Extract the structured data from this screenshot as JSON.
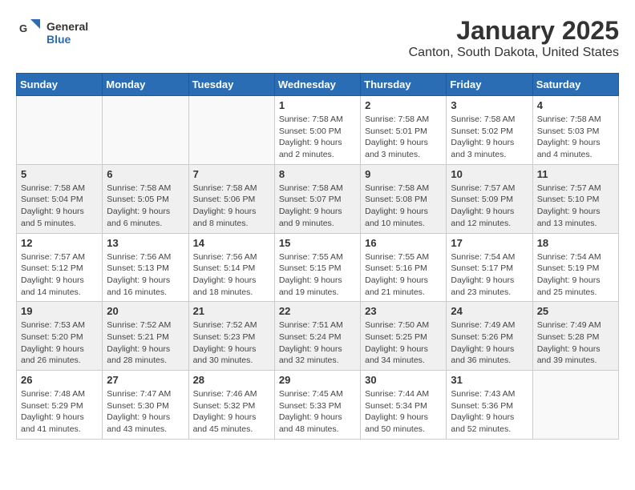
{
  "logo": {
    "general": "General",
    "blue": "Blue"
  },
  "title": "January 2025",
  "subtitle": "Canton, South Dakota, United States",
  "headers": [
    "Sunday",
    "Monday",
    "Tuesday",
    "Wednesday",
    "Thursday",
    "Friday",
    "Saturday"
  ],
  "weeks": [
    [
      {
        "day": "",
        "info": ""
      },
      {
        "day": "",
        "info": ""
      },
      {
        "day": "",
        "info": ""
      },
      {
        "day": "1",
        "info": "Sunrise: 7:58 AM\nSunset: 5:00 PM\nDaylight: 9 hours and 2 minutes."
      },
      {
        "day": "2",
        "info": "Sunrise: 7:58 AM\nSunset: 5:01 PM\nDaylight: 9 hours and 3 minutes."
      },
      {
        "day": "3",
        "info": "Sunrise: 7:58 AM\nSunset: 5:02 PM\nDaylight: 9 hours and 3 minutes."
      },
      {
        "day": "4",
        "info": "Sunrise: 7:58 AM\nSunset: 5:03 PM\nDaylight: 9 hours and 4 minutes."
      }
    ],
    [
      {
        "day": "5",
        "info": "Sunrise: 7:58 AM\nSunset: 5:04 PM\nDaylight: 9 hours and 5 minutes."
      },
      {
        "day": "6",
        "info": "Sunrise: 7:58 AM\nSunset: 5:05 PM\nDaylight: 9 hours and 6 minutes."
      },
      {
        "day": "7",
        "info": "Sunrise: 7:58 AM\nSunset: 5:06 PM\nDaylight: 9 hours and 8 minutes."
      },
      {
        "day": "8",
        "info": "Sunrise: 7:58 AM\nSunset: 5:07 PM\nDaylight: 9 hours and 9 minutes."
      },
      {
        "day": "9",
        "info": "Sunrise: 7:58 AM\nSunset: 5:08 PM\nDaylight: 9 hours and 10 minutes."
      },
      {
        "day": "10",
        "info": "Sunrise: 7:57 AM\nSunset: 5:09 PM\nDaylight: 9 hours and 12 minutes."
      },
      {
        "day": "11",
        "info": "Sunrise: 7:57 AM\nSunset: 5:10 PM\nDaylight: 9 hours and 13 minutes."
      }
    ],
    [
      {
        "day": "12",
        "info": "Sunrise: 7:57 AM\nSunset: 5:12 PM\nDaylight: 9 hours and 14 minutes."
      },
      {
        "day": "13",
        "info": "Sunrise: 7:56 AM\nSunset: 5:13 PM\nDaylight: 9 hours and 16 minutes."
      },
      {
        "day": "14",
        "info": "Sunrise: 7:56 AM\nSunset: 5:14 PM\nDaylight: 9 hours and 18 minutes."
      },
      {
        "day": "15",
        "info": "Sunrise: 7:55 AM\nSunset: 5:15 PM\nDaylight: 9 hours and 19 minutes."
      },
      {
        "day": "16",
        "info": "Sunrise: 7:55 AM\nSunset: 5:16 PM\nDaylight: 9 hours and 21 minutes."
      },
      {
        "day": "17",
        "info": "Sunrise: 7:54 AM\nSunset: 5:17 PM\nDaylight: 9 hours and 23 minutes."
      },
      {
        "day": "18",
        "info": "Sunrise: 7:54 AM\nSunset: 5:19 PM\nDaylight: 9 hours and 25 minutes."
      }
    ],
    [
      {
        "day": "19",
        "info": "Sunrise: 7:53 AM\nSunset: 5:20 PM\nDaylight: 9 hours and 26 minutes."
      },
      {
        "day": "20",
        "info": "Sunrise: 7:52 AM\nSunset: 5:21 PM\nDaylight: 9 hours and 28 minutes."
      },
      {
        "day": "21",
        "info": "Sunrise: 7:52 AM\nSunset: 5:23 PM\nDaylight: 9 hours and 30 minutes."
      },
      {
        "day": "22",
        "info": "Sunrise: 7:51 AM\nSunset: 5:24 PM\nDaylight: 9 hours and 32 minutes."
      },
      {
        "day": "23",
        "info": "Sunrise: 7:50 AM\nSunset: 5:25 PM\nDaylight: 9 hours and 34 minutes."
      },
      {
        "day": "24",
        "info": "Sunrise: 7:49 AM\nSunset: 5:26 PM\nDaylight: 9 hours and 36 minutes."
      },
      {
        "day": "25",
        "info": "Sunrise: 7:49 AM\nSunset: 5:28 PM\nDaylight: 9 hours and 39 minutes."
      }
    ],
    [
      {
        "day": "26",
        "info": "Sunrise: 7:48 AM\nSunset: 5:29 PM\nDaylight: 9 hours and 41 minutes."
      },
      {
        "day": "27",
        "info": "Sunrise: 7:47 AM\nSunset: 5:30 PM\nDaylight: 9 hours and 43 minutes."
      },
      {
        "day": "28",
        "info": "Sunrise: 7:46 AM\nSunset: 5:32 PM\nDaylight: 9 hours and 45 minutes."
      },
      {
        "day": "29",
        "info": "Sunrise: 7:45 AM\nSunset: 5:33 PM\nDaylight: 9 hours and 48 minutes."
      },
      {
        "day": "30",
        "info": "Sunrise: 7:44 AM\nSunset: 5:34 PM\nDaylight: 9 hours and 50 minutes."
      },
      {
        "day": "31",
        "info": "Sunrise: 7:43 AM\nSunset: 5:36 PM\nDaylight: 9 hours and 52 minutes."
      },
      {
        "day": "",
        "info": ""
      }
    ]
  ]
}
